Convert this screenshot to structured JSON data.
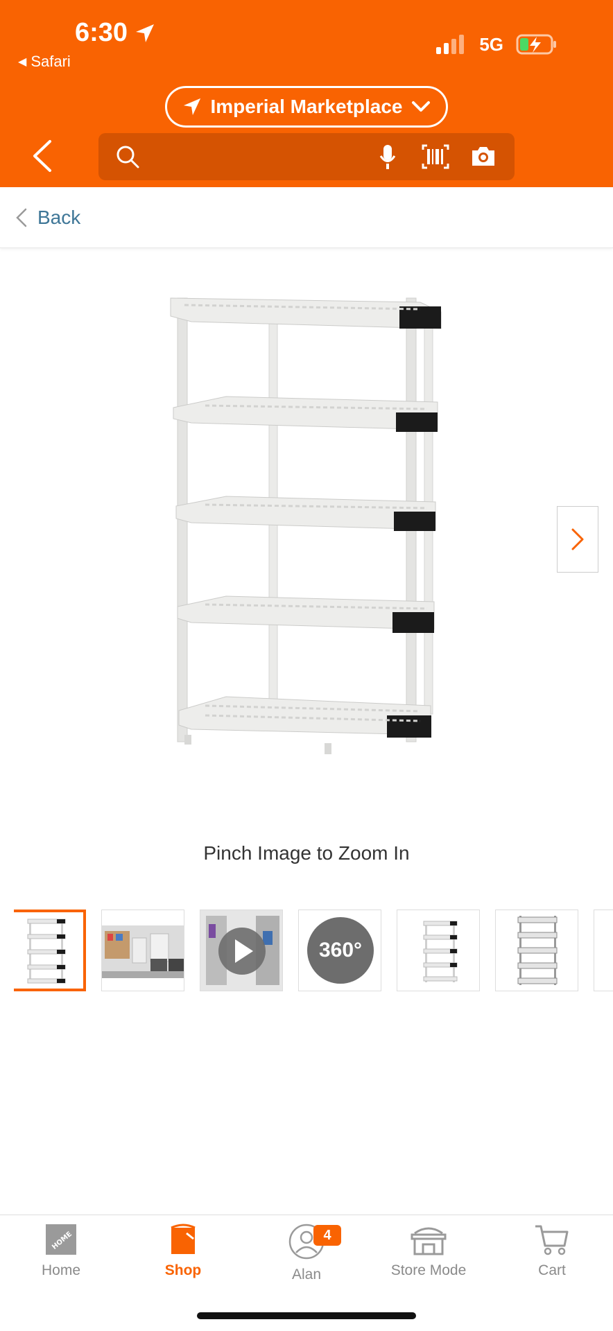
{
  "status_bar": {
    "time": "6:30",
    "back_app": "Safari",
    "network": "5G"
  },
  "header": {
    "store_name": "Imperial Marketplace",
    "search_placeholder": ""
  },
  "back_row": {
    "label": "Back"
  },
  "product": {
    "zoom_hint": "Pinch Image to Zoom In",
    "thumbnails": [
      {
        "kind": "image",
        "selected": true
      },
      {
        "kind": "image",
        "selected": false
      },
      {
        "kind": "video",
        "selected": false
      },
      {
        "kind": "360",
        "label": "360°",
        "selected": false
      },
      {
        "kind": "image",
        "selected": false
      },
      {
        "kind": "image",
        "selected": false
      }
    ]
  },
  "tabbar": {
    "tabs": [
      {
        "label": "Home",
        "icon": "home-depot-logo-icon",
        "active": false
      },
      {
        "label": "Shop",
        "icon": "bucket-icon",
        "active": true
      },
      {
        "label": "Alan",
        "icon": "user-icon",
        "active": false,
        "badge": "4"
      },
      {
        "label": "Store Mode",
        "icon": "store-icon",
        "active": false
      },
      {
        "label": "Cart",
        "icon": "cart-icon",
        "active": false
      }
    ]
  },
  "colors": {
    "brand": "#f96302",
    "link": "#3e7697"
  }
}
